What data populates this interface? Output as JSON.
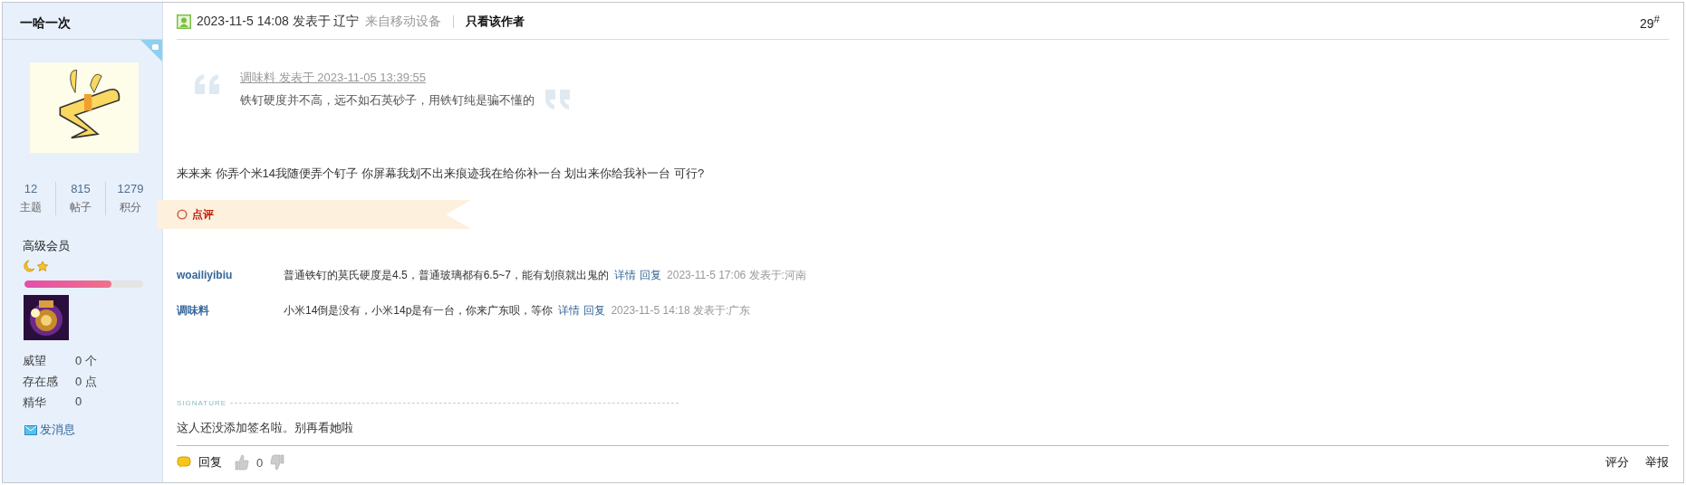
{
  "author": {
    "name": "一哈一次",
    "stats": [
      {
        "value": "12",
        "label": "主题"
      },
      {
        "value": "815",
        "label": "帖子"
      },
      {
        "value": "1279",
        "label": "积分"
      }
    ],
    "group": "高级会员",
    "progress": {
      "level": 0.73
    },
    "info": [
      {
        "label": "威望",
        "value": "0 个"
      },
      {
        "label": "存在感",
        "value": "0 点"
      },
      {
        "label": "精华",
        "value": "0"
      }
    ],
    "send_message": "发消息"
  },
  "post": {
    "time": "2023-11-5 14:08 发表于 辽宁",
    "device": "来自移动设备",
    "only_author": "只看该作者",
    "floor": "29$^{#}$",
    "quote": {
      "author_line": "调味料 发表于 2023-11-05 13:39:55",
      "text": "铁钉硬度并不高，远不如石英砂子，用铁钉纯是骗不懂的"
    },
    "body": "来来来 你弄个米14我随便弄个钉子 你屏幕我划不出来痕迹我在给你补一台 划出来你给我补一台 可行?",
    "comment_tab": "点评",
    "comments": [
      {
        "user": "woailiyibiu",
        "text": "普通铁钉的莫氏硬度是4.5，普通玻璃都有6.5~7，能有划痕就出鬼的",
        "links": [
          "详情",
          "回复"
        ],
        "meta": "2023-11-5 17:06 发表于:河南"
      },
      {
        "user": "调味料",
        "text": "小米14倒是没有，小米14p是有一台，你来广东呗，等你",
        "links": [
          "详情",
          "回复"
        ],
        "meta": "2023-11-5 14:18 发表于:广东"
      }
    ],
    "signature_label": "SIGNATURE",
    "signature": "这人还没添加签名啦。别再看她啦",
    "footer": {
      "reply": "回复",
      "likes": "0",
      "actions": [
        "评分",
        "举报"
      ]
    }
  }
}
